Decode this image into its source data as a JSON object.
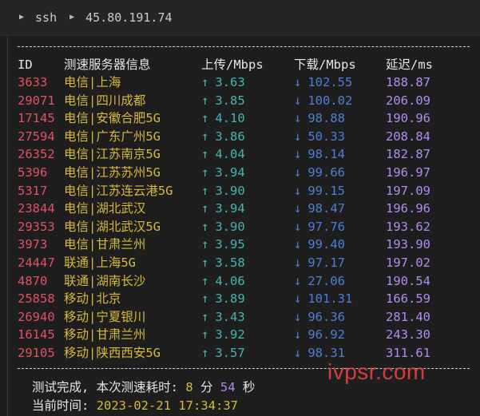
{
  "breadcrumb": {
    "items": [
      "ssh",
      "45.80.191.74"
    ]
  },
  "table": {
    "headers": {
      "id": "ID",
      "name": "测速服务器信息",
      "up": "上传/Mbps",
      "down": "下载/Mbps",
      "latency": "延迟/ms"
    },
    "rows": [
      {
        "id": "3633",
        "name": "电信|上海",
        "up": "3.63",
        "down": "102.55",
        "latency": "188.87"
      },
      {
        "id": "29071",
        "name": "电信|四川成都",
        "up": "3.85",
        "down": "100.02",
        "latency": "206.09"
      },
      {
        "id": "17145",
        "name": "电信|安徽合肥5G",
        "up": "4.10",
        "down": "98.88",
        "latency": "190.96"
      },
      {
        "id": "27594",
        "name": "电信|广东广州5G",
        "up": "3.86",
        "down": "50.33",
        "latency": "208.84"
      },
      {
        "id": "26352",
        "name": "电信|江苏南京5G",
        "up": "4.04",
        "down": "98.14",
        "latency": "182.87"
      },
      {
        "id": "5396",
        "name": "电信|江苏苏州5G",
        "up": "3.94",
        "down": "99.66",
        "latency": "196.97"
      },
      {
        "id": "5317",
        "name": "电信|江苏连云港5G",
        "up": "3.90",
        "down": "99.15",
        "latency": "197.09"
      },
      {
        "id": "23844",
        "name": "电信|湖北武汉",
        "up": "3.94",
        "down": "98.47",
        "latency": "196.96"
      },
      {
        "id": "29353",
        "name": "电信|湖北武汉5G",
        "up": "3.90",
        "down": "97.76",
        "latency": "193.62"
      },
      {
        "id": "3973",
        "name": "电信|甘肃兰州",
        "up": "3.95",
        "down": "99.40",
        "latency": "193.90"
      },
      {
        "id": "24447",
        "name": "联通|上海5G",
        "up": "3.58",
        "down": "97.17",
        "latency": "197.02"
      },
      {
        "id": "4870",
        "name": "联通|湖南长沙",
        "up": "4.06",
        "down": "27.06",
        "latency": "190.54"
      },
      {
        "id": "25858",
        "name": "移动|北京",
        "up": "3.89",
        "down": "101.31",
        "latency": "166.59"
      },
      {
        "id": "26940",
        "name": "移动|宁夏银川",
        "up": "3.43",
        "down": "96.36",
        "latency": "281.40"
      },
      {
        "id": "16145",
        "name": "移动|甘肃兰州",
        "up": "3.92",
        "down": "96.92",
        "latency": "243.30"
      },
      {
        "id": "29105",
        "name": "移动|陕西西安5G",
        "up": "3.57",
        "down": "98.31",
        "latency": "311.61"
      }
    ]
  },
  "summary": {
    "done_label": "测试完成, 本次测速耗时:",
    "minutes": "8",
    "minutes_unit": "分",
    "seconds": "54",
    "seconds_unit": "秒",
    "time_label": "当前时间:",
    "time_value": "2023-02-21 17:34:37"
  },
  "watermark": "ivpsr.com",
  "colors": {
    "background": "#1e1e1e",
    "id": "#e05263",
    "name": "#d7ba3a",
    "upload": "#43b5b5",
    "download": "#4d7fd4",
    "latency": "#b28bf0"
  }
}
